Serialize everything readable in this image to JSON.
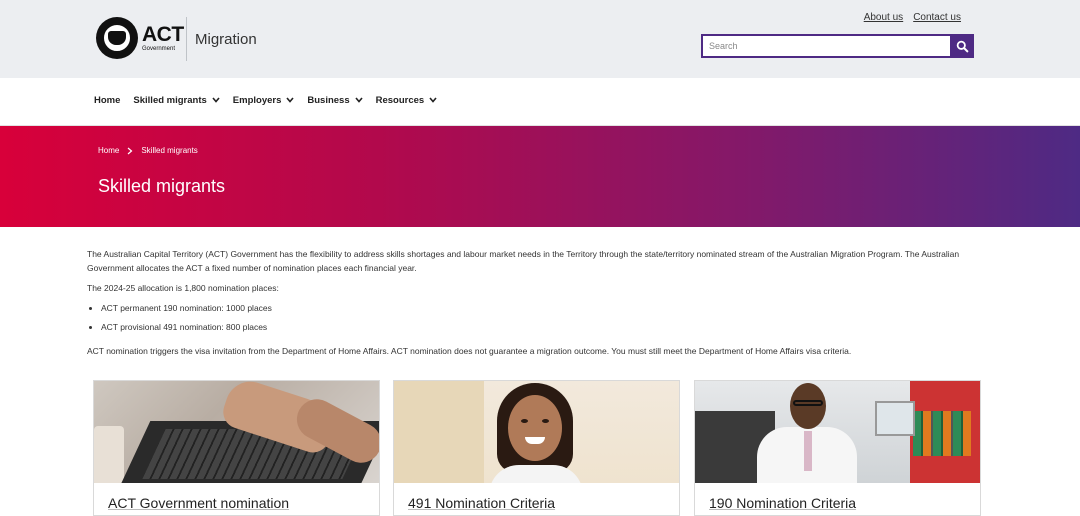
{
  "header": {
    "logo_text": "ACT",
    "logo_subtext": "Government",
    "site_name": "Migration",
    "util_links": [
      "About us",
      "Contact us"
    ],
    "search_placeholder": "Search"
  },
  "nav": {
    "items": [
      {
        "label": "Home",
        "has_dropdown": false
      },
      {
        "label": "Skilled migrants",
        "has_dropdown": true
      },
      {
        "label": "Employers",
        "has_dropdown": true
      },
      {
        "label": "Business",
        "has_dropdown": true
      },
      {
        "label": "Resources",
        "has_dropdown": true
      }
    ]
  },
  "banner": {
    "breadcrumb": [
      "Home",
      "Skilled migrants"
    ],
    "title": "Skilled migrants",
    "gradient_start": "#d8003a",
    "gradient_end": "#4e2a84"
  },
  "content": {
    "intro": "The Australian Capital Territory (ACT) Government has the flexibility to address skills shortages and labour market needs in the Territory through the state/territory nominated stream of the Australian Migration Program. The Australian Government allocates the ACT a fixed number of nomination places each financial year.",
    "allocation": "The 2024-25 allocation is 1,800 nomination places:",
    "bullets": [
      "ACT permanent 190 nomination: 1000 places",
      "ACT provisional 491 nomination: 800 places"
    ],
    "note": "ACT nomination triggers the visa invitation from the Department of Home Affairs. ACT nomination does not guarantee a migration outcome. You must still meet the Department of Home Affairs visa criteria."
  },
  "cards": [
    {
      "title": "ACT Government nomination",
      "image": "hands-typing-laptop"
    },
    {
      "title": "491 Nomination Criteria",
      "image": "smiling-woman"
    },
    {
      "title": "190 Nomination Criteria",
      "image": "man-in-office"
    }
  ],
  "colors": {
    "accent": "#4e2a84",
    "header_bg": "#eceef1"
  },
  "icons": {
    "search": "search-icon",
    "chevron": "chevron-down-icon",
    "breadcrumb_sep": "chevron-right-icon"
  }
}
